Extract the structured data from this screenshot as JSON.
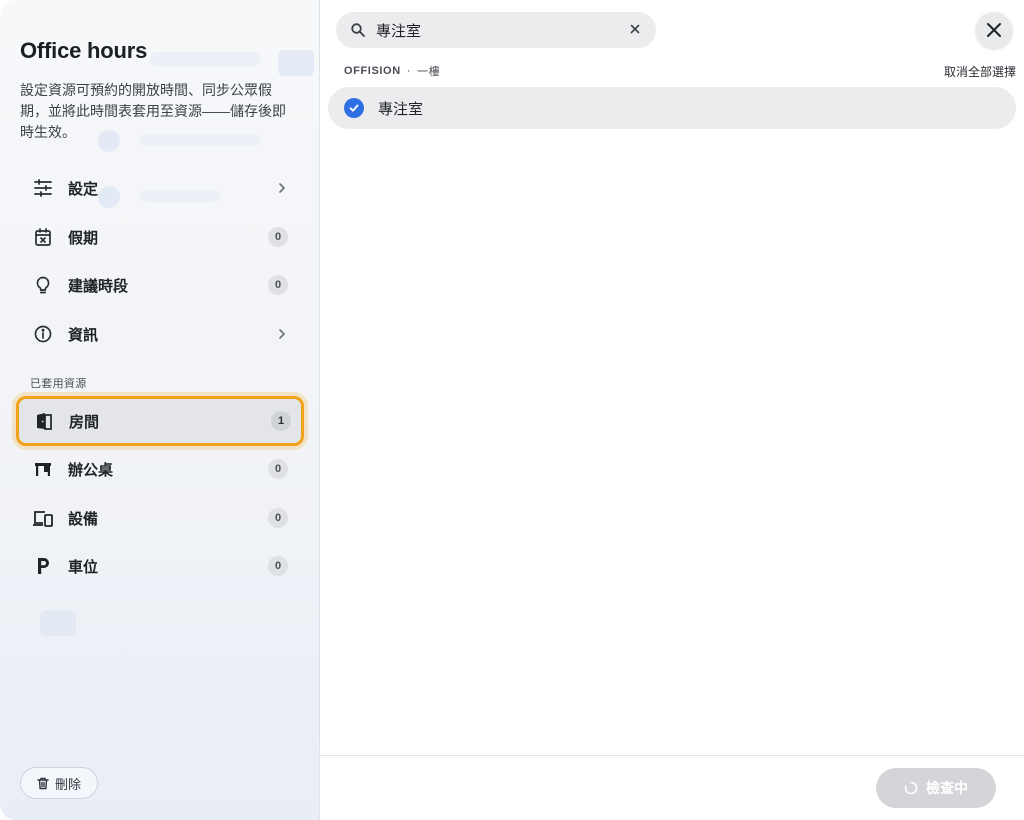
{
  "sidebar": {
    "title": "Office hours",
    "description": "設定資源可預約的開放時間、同步公眾假期，並將此時間表套用至資源——儲存後即時生效。",
    "items": [
      {
        "label": "設定",
        "icon": "sliders-icon",
        "trail": "chevron"
      },
      {
        "label": "假期",
        "icon": "calendar-x-icon",
        "count": "0"
      },
      {
        "label": "建議時段",
        "icon": "lightbulb-icon",
        "count": "0"
      },
      {
        "label": "資訊",
        "icon": "info-icon",
        "trail": "chevron"
      }
    ],
    "section_label": "已套用資源",
    "resources": [
      {
        "label": "房間",
        "icon": "room-door-icon",
        "count": "1",
        "active": true
      },
      {
        "label": "辦公桌",
        "icon": "desk-icon",
        "count": "0"
      },
      {
        "label": "設備",
        "icon": "devices-icon",
        "count": "0"
      },
      {
        "label": "車位",
        "icon": "parking-icon",
        "count": "0"
      }
    ],
    "delete_label": "刪除"
  },
  "search": {
    "value": "專注室"
  },
  "results": {
    "group_name": "OFFISION",
    "group_separator": "·",
    "group_floor": "一樓",
    "deselect_all": "取消全部選擇",
    "items": [
      {
        "label": "專注室",
        "checked": true
      }
    ]
  },
  "footer": {
    "primary_label": "檢查中"
  },
  "colors": {
    "accent": "#2f6fe4",
    "focus_ring": "#f0a21a",
    "disabled_button": "#d3d5d8"
  }
}
